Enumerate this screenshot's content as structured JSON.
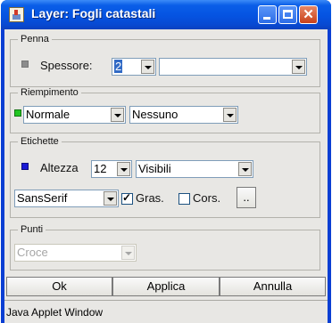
{
  "window": {
    "title": "Layer: Fogli catastali"
  },
  "penna": {
    "legend": "Penna",
    "spessore_label": "Spessore:",
    "spessore_value": "2",
    "style_value": "",
    "color": "#8c8c8c"
  },
  "riempimento": {
    "legend": "Riempimento",
    "color": "#22c522",
    "mode_value": "Normale",
    "pattern_value": "Nessuno"
  },
  "etichette": {
    "legend": "Etichette",
    "color": "#1a1ad6",
    "altezza_label": "Altezza",
    "altezza_value": "12",
    "visibility_value": "Visibili",
    "font_value": "SansSerif",
    "bold_label": "Gras.",
    "bold_checked": true,
    "italic_label": "Cors.",
    "italic_checked": false,
    "more_label": ".."
  },
  "punti": {
    "legend": "Punti",
    "symbol_value": "Croce"
  },
  "buttons": {
    "ok": "Ok",
    "apply": "Applica",
    "cancel": "Annulla"
  },
  "status": "Java Applet Window"
}
